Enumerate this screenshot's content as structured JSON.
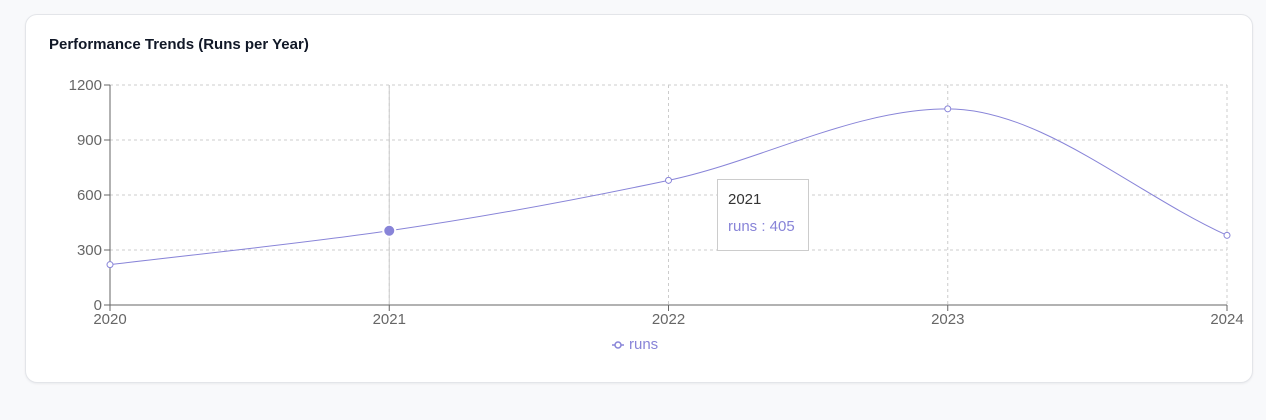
{
  "card": {
    "title": "Performance Trends (Runs per Year)"
  },
  "chart_data": {
    "type": "line",
    "title": "Performance Trends (Runs per Year)",
    "x": [
      "2020",
      "2021",
      "2022",
      "2023",
      "2024"
    ],
    "series": [
      {
        "name": "runs",
        "values": [
          220,
          405,
          680,
          1070,
          380
        ],
        "color": "#8884d8"
      }
    ],
    "ylim": [
      0,
      1200
    ],
    "yticks": [
      0,
      300,
      600,
      900,
      1200
    ],
    "grid": true,
    "grid_style": "dashed",
    "legend": "bottom-center",
    "curve": "smooth",
    "active_index": 1
  },
  "tooltip": {
    "label": "2021",
    "item_text": "runs : 405"
  },
  "legend": {
    "label": "runs"
  }
}
